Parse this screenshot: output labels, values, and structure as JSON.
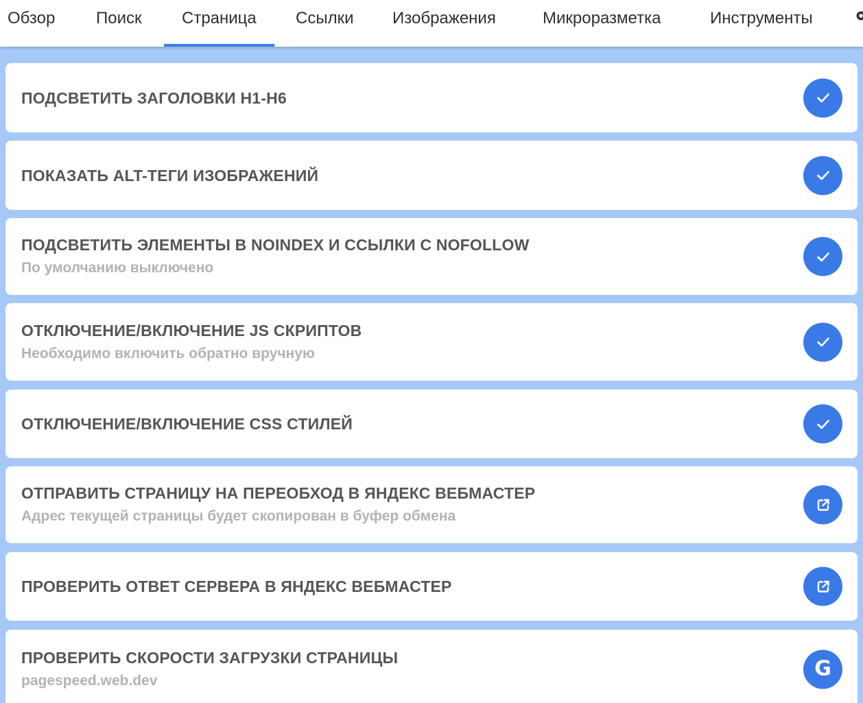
{
  "tabs": [
    {
      "label": "Обзор",
      "active": false
    },
    {
      "label": "Поиск",
      "active": false
    },
    {
      "label": "Страница",
      "active": true
    },
    {
      "label": "Ссылки",
      "active": false
    },
    {
      "label": "Изображения",
      "active": false
    },
    {
      "label": "Микроразметка",
      "active": false
    },
    {
      "label": "Инструменты",
      "active": false
    }
  ],
  "items": [
    {
      "title": "ПОДСВЕТИТЬ ЗАГОЛОВКИ H1-H6",
      "subtitle": "",
      "icon": "check-icon"
    },
    {
      "title": "ПОКАЗАТЬ ALT-ТЕГИ ИЗОБРАЖЕНИЙ",
      "subtitle": "",
      "icon": "check-icon"
    },
    {
      "title": "ПОДСВЕТИТЬ ЭЛЕМЕНТЫ В NOINDEX И ССЫЛКИ С NOFOLLOW",
      "subtitle": "По умолчанию выключено",
      "icon": "check-icon"
    },
    {
      "title": "ОТКЛЮЧЕНИЕ/ВКЛЮЧЕНИЕ JS СКРИПТОВ",
      "subtitle": "Необходимо включить обратно вручную",
      "icon": "check-icon"
    },
    {
      "title": "ОТКЛЮЧЕНИЕ/ВКЛЮЧЕНИЕ CSS СТИЛЕЙ",
      "subtitle": "",
      "icon": "check-icon"
    },
    {
      "title": "ОТПРАВИТЬ СТРАНИЦУ НА ПЕРЕОБХОД В ЯНДЕКС ВЕБМАСТЕР",
      "subtitle": "Адрес текущей страницы будет скопирован в буфер обмена",
      "icon": "external-link-icon"
    },
    {
      "title": "ПРОВЕРИТЬ ОТВЕТ СЕРВЕРА В ЯНДЕКС ВЕБМАСТЕР",
      "subtitle": "",
      "icon": "external-link-icon"
    },
    {
      "title": "ПРОВЕРИТЬ СКОРОСТИ ЗАГРУЗКИ СТРАНИЦЫ",
      "subtitle": "pagespeed.web.dev",
      "icon": "google-icon",
      "icon_letter": "G"
    }
  ],
  "colors": {
    "accent": "#3a7ae6",
    "background": "#a6c8f7",
    "title_text": "#555555",
    "subtitle_text": "#b3b3b3"
  }
}
